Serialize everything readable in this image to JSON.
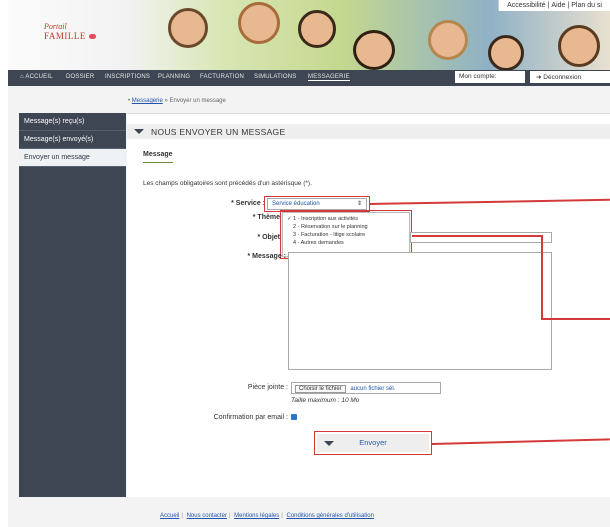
{
  "header": {
    "logo_line1": "Portail",
    "logo_line2": "FAMILLE",
    "top_links": [
      "Accessibilité",
      "Aide",
      "Plan du si"
    ]
  },
  "nav": {
    "items": [
      "ACCUEIL",
      "DOSSIER",
      "INSCRIPTIONS",
      "PLANNING",
      "FACTURATION",
      "SIMULATIONS",
      "MESSAGERIE"
    ],
    "active": "MESSAGERIE",
    "account_label": "Mon compte:",
    "logout_label": "Déconnexion",
    "home_icon": "home-icon",
    "logout_icon": "logout-icon"
  },
  "breadcrumb": {
    "link": "Messagerie",
    "separator": "»",
    "current": "Envoyer un message"
  },
  "sidebar": {
    "items": [
      "Message(s) reçu(s)",
      "Message(s) envoyé(s)",
      "Envoyer un message"
    ],
    "active_index": 2
  },
  "panel": {
    "title": "NOUS ENVOYER UN MESSAGE",
    "tab_label": "Message",
    "mandatory_note": "Les champs obligatoires sont précédés d'un astérisque (*)."
  },
  "form": {
    "service_label": "* Service :",
    "service_value": "Service éducation",
    "service_arrow": "⇕",
    "theme_label": "* Thème",
    "theme_options": [
      "✓ 1 - Inscription aux activités",
      "2 - Réservation sur le planning",
      "3 - Facturation - litige scolaire",
      "4 - Autres demandes"
    ],
    "objet_label": "* Objet",
    "message_label": "* Message :",
    "attachment_label": "Pièce jointe :",
    "choose_file": "Choisir le fichier",
    "no_file": "aucun fichier sél.",
    "max_size": "Taille maximum : 10 Mo",
    "email_confirm_label": "Confirmation par email :",
    "email_confirm_checked": true,
    "send_label": "Envoyer"
  },
  "footer": {
    "links": [
      "Accueil",
      "Nous contacter",
      "Mentions légales",
      "Conditions générales d'utilisation"
    ]
  },
  "colors": {
    "nav_bg": "#3e4653",
    "highlight_red": "#d43a3a",
    "link_blue": "#2255aa"
  }
}
